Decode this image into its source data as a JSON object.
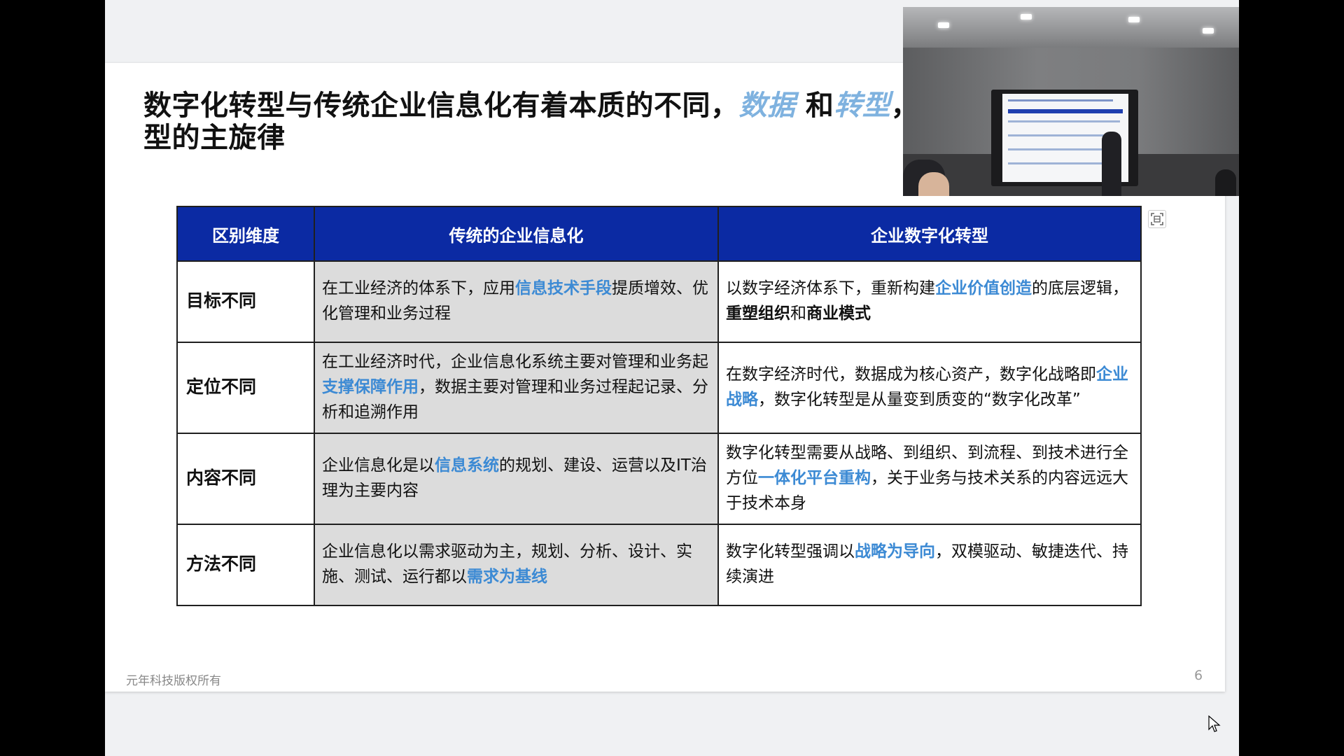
{
  "slide": {
    "title_part1": "数字化转型与传统企业信息化有着本质的不同，",
    "title_hl1": "数据",
    "title_mid": " 和",
    "title_hl2": "转型",
    "title_part2": "，",
    "title_line2": "型的主旋律",
    "footer_text": "元年科技版权所有",
    "page_number": "6"
  },
  "table": {
    "headers": [
      "区别维度",
      "传统的企业信息化",
      "企业数字化转型"
    ],
    "rows": [
      {
        "dimension": "目标不同",
        "traditional": [
          {
            "t": "在工业经济的体系下，应用"
          },
          {
            "t": "信息技术手段",
            "s": "hl"
          },
          {
            "t": "提质增效、优化管理和业务过程"
          }
        ],
        "digital": [
          {
            "t": "以数字经济体系下，重新构建"
          },
          {
            "t": "企业价值创造",
            "s": "hl"
          },
          {
            "t": "的底层逻辑，"
          },
          {
            "t": "重塑组织",
            "s": "b"
          },
          {
            "t": "和"
          },
          {
            "t": "商业模式",
            "s": "b"
          }
        ]
      },
      {
        "dimension": "定位不同",
        "traditional": [
          {
            "t": "在工业经济时代，企业信息化系统主要对管理和业务起"
          },
          {
            "t": "支撑保障作用",
            "s": "hl"
          },
          {
            "t": "，数据主要对管理和业务过程起记录、分析和追溯作用"
          }
        ],
        "digital": [
          {
            "t": "在数字经济时代，数据成为核心资产，数字化战略即"
          },
          {
            "t": "企业战略",
            "s": "hl"
          },
          {
            "t": "，数字化转型是从量变到质变的“数字化改革”"
          }
        ]
      },
      {
        "dimension": "内容不同",
        "traditional": [
          {
            "t": "企业信息化是以"
          },
          {
            "t": "信息系统",
            "s": "hl"
          },
          {
            "t": "的规划、建设、运营以及IT治理为主要内容"
          }
        ],
        "digital": [
          {
            "t": "数字化转型需要从战略、到组织、到流程、到技术进行全方位"
          },
          {
            "t": "一体化平台重构",
            "s": "hl"
          },
          {
            "t": "，关于业务与技术关系的内容远远大于技术本身"
          }
        ]
      },
      {
        "dimension": "方法不同",
        "traditional": [
          {
            "t": "企业信息化以需求驱动为主，规划、分析、设计、实施、测试、运行都以"
          },
          {
            "t": "需求为基线",
            "s": "hl"
          }
        ],
        "digital": [
          {
            "t": "数字化转型强调以"
          },
          {
            "t": "战略为导向",
            "s": "hl"
          },
          {
            "t": "，双模驱动、敏捷迭代、持续演进"
          }
        ]
      }
    ]
  },
  "colors": {
    "header_bg": "#0b2aa3",
    "highlight_text": "#3c8ad4",
    "title_highlight": "#7fb2df",
    "traditional_cell_bg": "#dcdcdc"
  },
  "icons": {
    "capture_button": "capture-region-icon",
    "cursor": "mouse-pointer-icon"
  }
}
